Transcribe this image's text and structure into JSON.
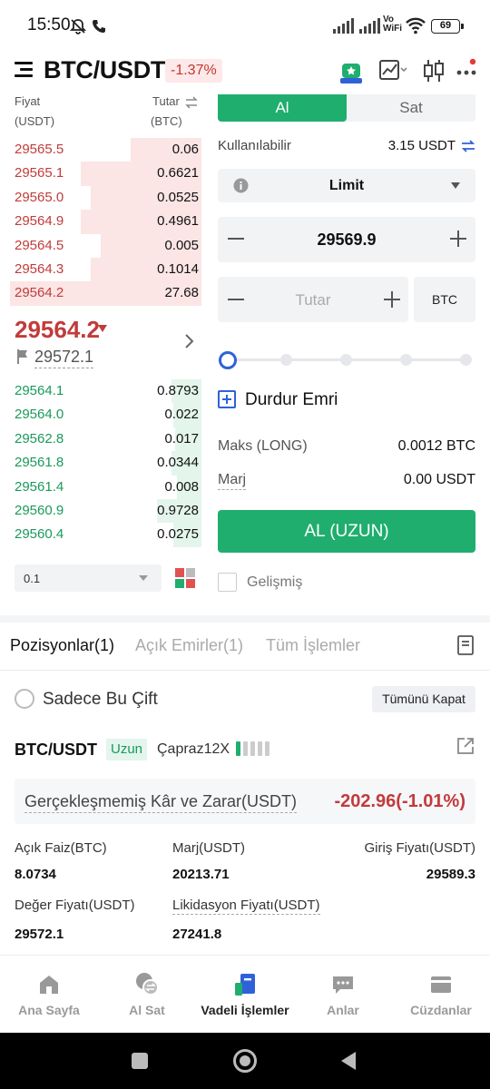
{
  "status_bar": {
    "time": "15:50",
    "battery": "69",
    "network": "Vo WiFi"
  },
  "header": {
    "pair": "BTC/USDT",
    "change": "-1.37%"
  },
  "orderbook": {
    "price_header": "Fiyat",
    "price_unit": "(USDT)",
    "amount_header": "Tutar",
    "amount_unit": "(BTC)",
    "asks": [
      {
        "price": "29565.5",
        "qty": "0.06",
        "depth": 0.35
      },
      {
        "price": "29565.1",
        "qty": "0.6621",
        "depth": 0.6
      },
      {
        "price": "29565.0",
        "qty": "0.0525",
        "depth": 0.55
      },
      {
        "price": "29564.9",
        "qty": "0.4961",
        "depth": 0.6
      },
      {
        "price": "29564.5",
        "qty": "0.005",
        "depth": 0.5
      },
      {
        "price": "29564.3",
        "qty": "0.1014",
        "depth": 0.55
      },
      {
        "price": "29564.2",
        "qty": "27.68",
        "depth": 0.95
      }
    ],
    "last_price": "29564.2",
    "mark_price": "29572.1",
    "bids": [
      {
        "price": "29564.1",
        "qty": "0.8793",
        "depth": 0.15
      },
      {
        "price": "29564.0",
        "qty": "0.022",
        "depth": 0.14
      },
      {
        "price": "29562.8",
        "qty": "0.017",
        "depth": 0.13
      },
      {
        "price": "29561.8",
        "qty": "0.0344",
        "depth": 0.15
      },
      {
        "price": "29561.4",
        "qty": "0.008",
        "depth": 0.12
      },
      {
        "price": "29560.9",
        "qty": "0.9728",
        "depth": 0.22
      },
      {
        "price": "29560.4",
        "qty": "0.0275",
        "depth": 0.14
      }
    ],
    "precision": "0.1"
  },
  "form": {
    "tab_buy": "Al",
    "tab_sell": "Sat",
    "available_label": "Kullanılabilir",
    "available_value": "3.15 USDT",
    "order_type": "Limit",
    "price_value": "29569.9",
    "amount_placeholder": "Tutar",
    "amount_unit": "BTC",
    "stop_order_label": "Durdur Emri",
    "max_label": "Maks (LONG)",
    "max_value": "0.0012 BTC",
    "margin_label": "Marj",
    "margin_value": "0.00 USDT",
    "buy_button": "AL (UZUN)",
    "advanced_label": "Gelişmiş"
  },
  "positions": {
    "tabs": [
      "Pozisyonlar(1)",
      "Açık Emirler(1)",
      "Tüm İşlemler"
    ],
    "only_pair_label": "Sadece Bu Çift",
    "close_all_label": "Tümünü Kapat",
    "pair": "BTC/USDT",
    "side": "Uzun",
    "mode": "Çapraz12X",
    "pnl_label": "Gerçekleşmemiş Kâr ve Zarar(USDT)",
    "pnl_value": "-202.96(-1.01%)",
    "open_interest_label": "Açık Faiz(BTC)",
    "open_interest_value": "8.0734",
    "margin_label": "Marj(USDT)",
    "margin_value": "20213.71",
    "entry_label": "Giriş Fiyatı(USDT)",
    "entry_value": "29589.3",
    "mark_label": "Değer Fiyatı(USDT)",
    "mark_value": "29572.1",
    "liq_label": "Likidasyon Fiyatı(USDT)",
    "liq_value": "27241.8"
  },
  "bottom_nav": [
    "Ana Sayfa",
    "Al Sat",
    "Vadeli İşlemler",
    "Anlar",
    "Cüzdanlar"
  ],
  "colors": {
    "green": "#1fae6e",
    "red": "#c23b3b",
    "ask_bg": "#fbe5e5",
    "bid_bg": "#e4f5ec"
  }
}
